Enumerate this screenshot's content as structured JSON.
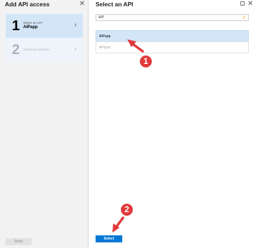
{
  "left_panel": {
    "title": "Add API access",
    "close_glyph": "✕",
    "steps": [
      {
        "number": "1",
        "label": "Select an API",
        "value": "AIPapp",
        "chevron": "›",
        "state": "active"
      },
      {
        "number": "2",
        "label": "Select permissions",
        "chevron": "›",
        "state": "disabled"
      }
    ],
    "done_label": "Done"
  },
  "right_panel": {
    "title": "Select an API",
    "maximize_icon": "maximize-icon",
    "close_glyph": "✕",
    "search": {
      "value": "AIP",
      "valid_glyph": "✓"
    },
    "results": [
      {
        "label": "AIPapp",
        "selected": true
      },
      {
        "label": "APIcert",
        "selected": false
      }
    ],
    "select_label": "Select"
  },
  "annotations": [
    {
      "label": "1",
      "color": "#e0393c"
    },
    {
      "label": "2",
      "color": "#e0393c"
    }
  ],
  "colors": {
    "accent": "#0078d4",
    "selection": "#d3e6f8",
    "annotation": "#e0393c",
    "valid_check": "#d4a300"
  }
}
